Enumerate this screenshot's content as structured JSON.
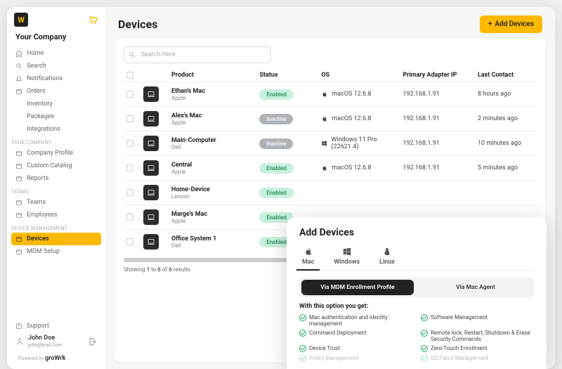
{
  "company_name": "Your Company",
  "sidebar": {
    "items_main": [
      {
        "label": "Home",
        "icon": "home"
      },
      {
        "label": "Search",
        "icon": "search"
      },
      {
        "label": "Notifications",
        "icon": "bell"
      },
      {
        "label": "Orders",
        "icon": "box"
      },
      {
        "label": "Inventory",
        "icon": "archive"
      },
      {
        "label": "Packages",
        "icon": "package"
      },
      {
        "label": "Integrations",
        "icon": "plug"
      }
    ],
    "section_company": "YOUR COMPANY",
    "items_company": [
      {
        "label": "Company Profile"
      },
      {
        "label": "Custom Catalog"
      },
      {
        "label": "Reports"
      }
    ],
    "section_teams": "TEAMS",
    "items_teams": [
      {
        "label": "Teams"
      },
      {
        "label": "Employees"
      }
    ],
    "section_device": "DEVICE MANAGEMENT",
    "items_device": [
      {
        "label": "Devices",
        "active": true
      },
      {
        "label": "MDM Setup"
      }
    ],
    "support_label": "Support"
  },
  "user": {
    "name": "John Doe",
    "email": "john@mail.com"
  },
  "powered_by_prefix": "Powered by",
  "powered_by_brand": "groWrk",
  "page": {
    "title": "Devices",
    "add_button": "Add Devices",
    "search_placeholder": "Search Here"
  },
  "table": {
    "headers": [
      "Product",
      "Status",
      "OS",
      "Primary Adapter IP",
      "Last Contact"
    ],
    "rows": [
      {
        "name": "Ethan's Mac",
        "vendor": "Apple",
        "status": "Enabled",
        "os_icon": "apple",
        "os": "macOS 12.6.8",
        "ip": "192.168.1.91",
        "last": "8 hours ago"
      },
      {
        "name": "Alex's Mac",
        "vendor": "Apple",
        "status": "Inactive",
        "os_icon": "apple",
        "os": "macOS 12.6.8",
        "ip": "192.168.1.91",
        "last": "2 minutes ago"
      },
      {
        "name": "Main-Computer",
        "vendor": "Dell",
        "status": "Inactive",
        "os_icon": "windows",
        "os": "Windows 11 Pro (22621.4)",
        "ip": "192.168.1.91",
        "last": "10 minutes ago"
      },
      {
        "name": "Central",
        "vendor": "Apple",
        "status": "Enabled",
        "os_icon": "apple",
        "os": "macOS 12.6.8",
        "ip": "192.168.1.91",
        "last": "5 minutes ago"
      },
      {
        "name": "Home-Device",
        "vendor": "Lenovo",
        "status": "Enabled",
        "os_icon": "",
        "os": "",
        "ip": "",
        "last": ""
      },
      {
        "name": "Marge's Mac",
        "vendor": "Apple",
        "status": "Enabled",
        "os_icon": "",
        "os": "",
        "ip": "",
        "last": ""
      },
      {
        "name": "Office System 1",
        "vendor": "Dell",
        "status": "Enabled",
        "os_icon": "",
        "os": "",
        "ip": "",
        "last": ""
      }
    ],
    "results_text": "Showing 1 to 6 of 6 results"
  },
  "modal": {
    "title": "Add Devices",
    "tabs": [
      {
        "label": "Mac",
        "icon": "apple",
        "active": true
      },
      {
        "label": "Windows",
        "icon": "windows"
      },
      {
        "label": "Linux",
        "icon": "linux"
      }
    ],
    "methods": [
      {
        "label": "Via MDM Enrollment Profile",
        "active": true
      },
      {
        "label": "Via Mac Agent"
      }
    ],
    "option_heading": "With this option you get:",
    "features_left": [
      "Mac authentication and identity management",
      "Command Deployment",
      "Device Trust",
      "Policy Management"
    ],
    "features_right": [
      "Software Management",
      "Remote lock, Restart, Shutdown & Erase Security Commands",
      "Zero-Touch Enrollment",
      "OS Patch Management"
    ]
  }
}
